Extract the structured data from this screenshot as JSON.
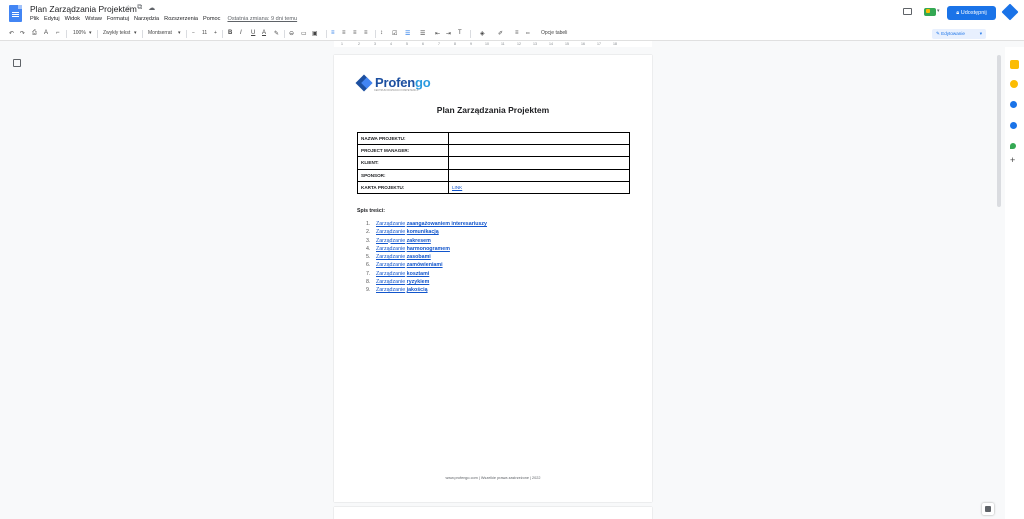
{
  "window": {
    "title": "Plan Zarządzania Projektem",
    "title_icons": [
      "☆",
      "⧉",
      "☁"
    ],
    "menu": [
      "Plik",
      "Edytuj",
      "Widok",
      "Wstaw",
      "Formatuj",
      "Narzędzia",
      "Rozszerzenia",
      "Pomoc"
    ],
    "last_edit": "Ostatnia zmiana: 9 dni temu",
    "share_label": "Udostępnij",
    "share_icon": "lock-icon",
    "brand_color": "#1a73e8"
  },
  "toolbar": {
    "zoom": "100%",
    "style": "Zwykły tekst",
    "font": "Montserrat",
    "font_size": "11",
    "bold": "B",
    "italic": "I",
    "underline": "U",
    "text_color": "A",
    "minus": "−",
    "plus": "+",
    "table_options": "Opcje tabeli",
    "mode": "Edytowanie"
  },
  "ruler": [
    "1",
    "2",
    "3",
    "4",
    "5",
    "6",
    "7",
    "8",
    "9",
    "10",
    "11",
    "12",
    "13",
    "14",
    "15",
    "16",
    "17",
    "18"
  ],
  "document": {
    "logo_prefix": "Profen",
    "logo_suffix": "go",
    "logo_tagline": "CENTRUM ROZWOJU KOMPETENCJI",
    "heading": "Plan Zarządzania Projektem",
    "table": [
      {
        "label": "NAZWA PROJEKTU:",
        "value": ""
      },
      {
        "label": "PROJECT MANAGER:",
        "value": ""
      },
      {
        "label": "KLIENT:",
        "value": ""
      },
      {
        "label": "SPONSOR:",
        "value": ""
      },
      {
        "label": "KARTA PROJEKTU:",
        "value": "LINK"
      }
    ],
    "toc_title": "Spis treści:",
    "toc": [
      {
        "num": "1.",
        "prefix": "Zarządzanie",
        "topic": "zaangażowaniem interesariuszy"
      },
      {
        "num": "2.",
        "prefix": "Zarządzanie",
        "topic": "komunikacją"
      },
      {
        "num": "3.",
        "prefix": "Zarządzanie",
        "topic": "zakresem"
      },
      {
        "num": "4.",
        "prefix": "Zarządzanie",
        "topic": "harmonogramem"
      },
      {
        "num": "5.",
        "prefix": "Zarządzanie",
        "topic": "zasobami"
      },
      {
        "num": "6.",
        "prefix": "Zarządzanie",
        "topic": "zamówieniami"
      },
      {
        "num": "7.",
        "prefix": "Zarządzanie",
        "topic": "kosztami"
      },
      {
        "num": "8.",
        "prefix": "Zarządzanie",
        "topic": "ryzykiem"
      },
      {
        "num": "9.",
        "prefix": "Zarządzanie",
        "topic": "jakością"
      }
    ],
    "footer": "www.profengo.com | Wszelkie prawa zastrzeżone | 2022"
  },
  "side_panel": {
    "plus": "+"
  }
}
